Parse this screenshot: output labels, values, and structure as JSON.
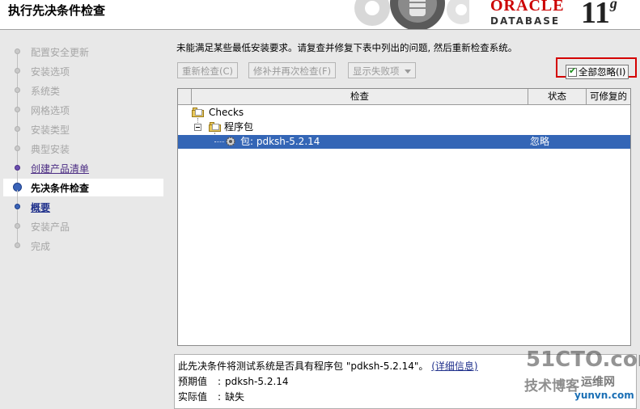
{
  "header": {
    "title": "执行先决条件检查",
    "brand": {
      "oracle": "ORACLE",
      "database": "DATABASE",
      "version": "11",
      "version_suffix": "g"
    }
  },
  "sidebar": {
    "steps": [
      {
        "label": "配置安全更新",
        "state": "done"
      },
      {
        "label": "安装选项",
        "state": "done"
      },
      {
        "label": "系统类",
        "state": "done"
      },
      {
        "label": "网格选项",
        "state": "done"
      },
      {
        "label": "安装类型",
        "state": "done"
      },
      {
        "label": "典型安装",
        "state": "done"
      },
      {
        "label": "创建产品清单",
        "state": "link"
      },
      {
        "label": "先决条件检查",
        "state": "current"
      },
      {
        "label": "概要",
        "state": "next"
      },
      {
        "label": "安装产品",
        "state": "pending"
      },
      {
        "label": "完成",
        "state": "pending"
      }
    ]
  },
  "main": {
    "instruction": "未能满足某些最低安装要求。请复查并修复下表中列出的问题, 然后重新检查系统。",
    "buttons": {
      "recheck": "重新检查(C)",
      "fix_and_check": "修补并再次检查(F)",
      "show_failed": "显示失败项"
    },
    "ignore_all": {
      "label": "全部忽略(I)",
      "checked": true
    }
  },
  "table": {
    "columns": [
      "检查",
      "状态",
      "可修复的"
    ],
    "rows": [
      {
        "label": "Checks",
        "level": 0,
        "status": ""
      },
      {
        "label": "程序包",
        "level": 1,
        "status": ""
      },
      {
        "label": "包: pdksh-5.2.14",
        "level": 2,
        "status": "忽略",
        "selected": true
      }
    ]
  },
  "detail": {
    "description": "此先决条件将测试系统是否具有程序包 \"pdksh-5.2.14\"。",
    "link": "(详细信息)",
    "expected_label": "预期值",
    "expected_value": "pdksh-5.2.14",
    "actual_label": "实际值",
    "actual_value": "缺失",
    "separator": ":"
  },
  "watermark": {
    "site": "51CTO.com",
    "blog": "技术博客",
    "yunwei": "运维网",
    "domain": "yunvn.com"
  },
  "colors": {
    "selection": "#3466b6",
    "highlight_border": "#d40000",
    "brand_red": "#cc0000",
    "link": "#20318c"
  }
}
